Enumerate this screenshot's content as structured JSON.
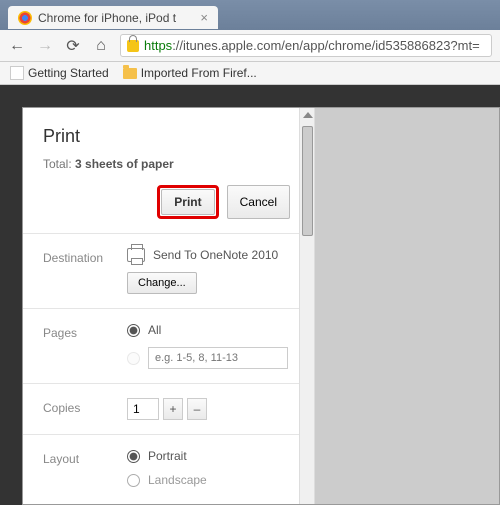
{
  "tab": {
    "title": "Chrome for iPhone, iPod t"
  },
  "url": {
    "scheme": "https",
    "rest": "://itunes.apple.com/en/app/chrome/id535886823?mt="
  },
  "bookmarks": {
    "getting_started": "Getting Started",
    "imported": "Imported From Firef..."
  },
  "print": {
    "title": "Print",
    "total_prefix": "Total: ",
    "total_value": "3 sheets of paper",
    "print_btn": "Print",
    "cancel_btn": "Cancel",
    "destination_label": "Destination",
    "destination_value": "Send To OneNote 2010",
    "change_btn": "Change...",
    "pages_label": "Pages",
    "pages_all": "All",
    "pages_placeholder": "e.g. 1-5, 8, 11-13",
    "copies_label": "Copies",
    "copies_value": "1",
    "layout_label": "Layout",
    "layout_portrait": "Portrait",
    "layout_landscape": "Landscape"
  }
}
